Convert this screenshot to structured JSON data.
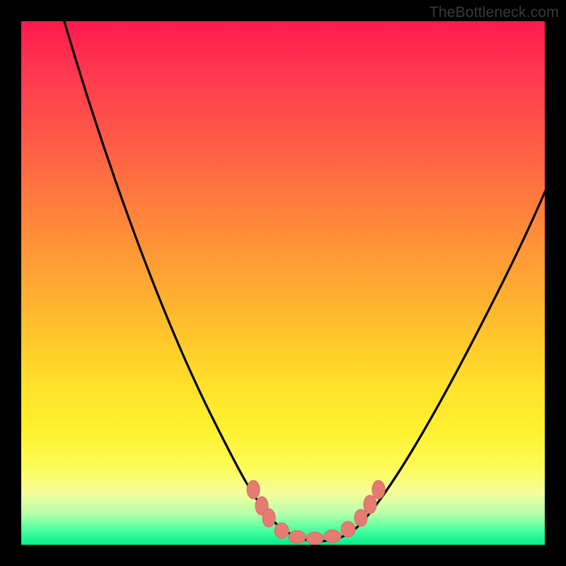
{
  "attribution": "TheBottleneck.com",
  "colors": {
    "frame": "#000000",
    "gradient_top": "#ff1a4d",
    "gradient_bottom": "#00f08c",
    "curve_stroke": "#000000",
    "marker_stroke": "#d86a62",
    "marker_fill": "#e57b73"
  },
  "chart_data": {
    "type": "line",
    "title": "",
    "xlabel": "",
    "ylabel": "",
    "xlim": [
      0,
      100
    ],
    "ylim": [
      0,
      100
    ],
    "series": [
      {
        "name": "bottleneck-curve",
        "x": [
          8,
          12,
          16,
          20,
          24,
          28,
          32,
          36,
          40,
          44,
          48,
          50,
          52,
          54,
          56,
          58,
          60,
          64,
          68,
          72,
          76,
          80,
          84,
          88,
          92,
          96,
          100
        ],
        "y": [
          100,
          92,
          84,
          76,
          68,
          60,
          52,
          44,
          36,
          27,
          16,
          10,
          6,
          3,
          1.5,
          1,
          1.5,
          3,
          8,
          14,
          20,
          26,
          32,
          38,
          44,
          50,
          58
        ]
      }
    ],
    "annotations": {
      "highlight_markers_x": [
        44,
        46,
        48,
        50,
        54,
        58,
        62,
        65,
        67,
        68,
        70
      ],
      "highlight_markers_y": [
        23,
        18,
        13,
        8,
        2,
        1,
        2,
        5,
        9,
        12,
        17
      ]
    }
  }
}
